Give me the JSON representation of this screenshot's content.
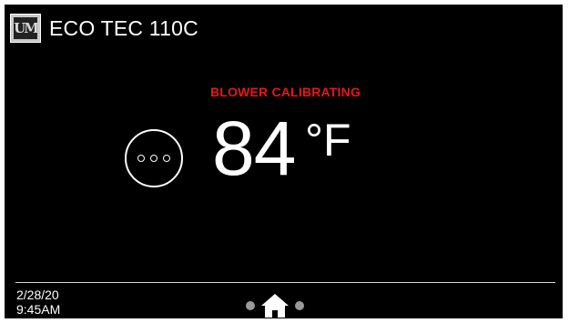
{
  "header": {
    "logo_text": "UM",
    "title": "ECO TEC 110C"
  },
  "status": {
    "text": "BLOWER CALIBRATING",
    "color": "#e0191b"
  },
  "temperature": {
    "value": "84",
    "unit": "°F"
  },
  "footer": {
    "date": "2/28/20",
    "time": "9:45AM"
  },
  "nav": {
    "icons": [
      "page-dot",
      "home-icon",
      "page-dot"
    ],
    "current": "home"
  },
  "colors": {
    "background": "#000000",
    "foreground": "#ffffff",
    "alert": "#e0191b",
    "inactive_dot": "#9a9a9a"
  }
}
